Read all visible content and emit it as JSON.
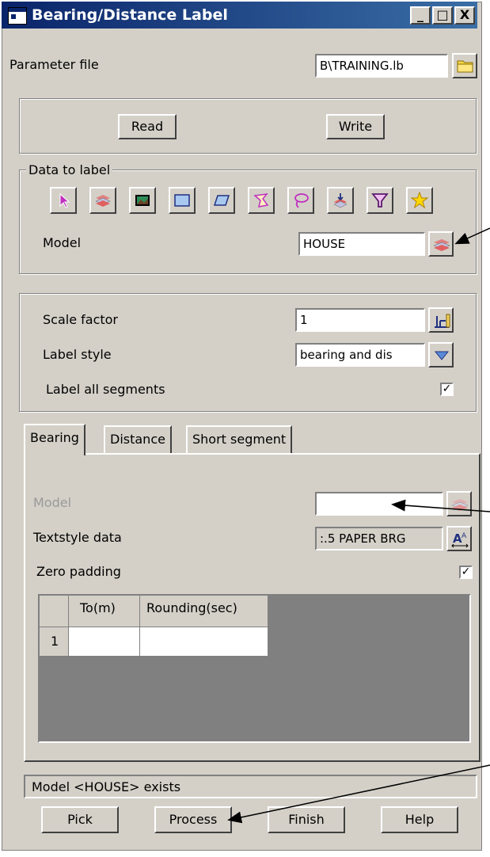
{
  "window": {
    "title": "Bearing/Distance Label"
  },
  "title_buttons": {
    "minimize": "_",
    "maximize": "□",
    "close": "X"
  },
  "parameter_file": {
    "label": "Parameter file",
    "value": "B\\TRAINING.lb"
  },
  "io_buttons": {
    "read": "Read",
    "write": "Write"
  },
  "data_to_label": {
    "title": "Data to label",
    "icons": [
      "cursor-icon",
      "layers-icon",
      "picture-icon",
      "rectangle-icon",
      "parallelogram-icon",
      "polygon-icon",
      "lasso-icon",
      "stack-icon",
      "filter-icon",
      "star-icon"
    ],
    "model_label": "Model",
    "model_value": "HOUSE"
  },
  "settings": {
    "scale_factor_label": "Scale factor",
    "scale_factor_value": "1",
    "label_style_label": "Label style",
    "label_style_value": "bearing and dis",
    "label_all_segments_label": "Label all segments",
    "label_all_segments_checked": "✓"
  },
  "tabs": [
    "Bearing",
    "Distance",
    "Short segment"
  ],
  "bearing_tab": {
    "model_label": "Model",
    "model_value": "",
    "textstyle_label": "Textstyle data",
    "textstyle_value": ":.5 PAPER BRG",
    "zero_padding_label": "Zero padding",
    "zero_padding_checked": "✓",
    "table": {
      "columns": [
        "",
        "To(m)",
        "Rounding(sec)"
      ],
      "rows": [
        [
          "1",
          "",
          ""
        ]
      ]
    }
  },
  "status": "Model <HOUSE> exists",
  "bottom_buttons": {
    "pick": "Pick",
    "process": "Process",
    "finish": "Finish",
    "help": "Help"
  },
  "colors": {
    "titlebar": "#0a246a",
    "face": "#d4d0c8",
    "grid_bg": "#808080"
  }
}
